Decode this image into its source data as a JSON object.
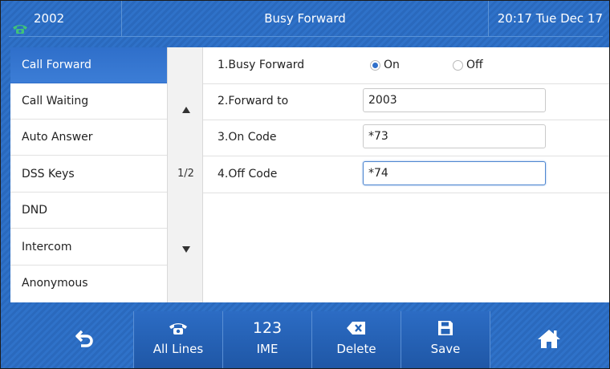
{
  "header": {
    "line_number": "2002",
    "title": "Busy Forward",
    "datetime": "20:17 Tue Dec 17",
    "phone_icon_color": "#3fc27a"
  },
  "menu": {
    "items": [
      {
        "label": "Call Forward",
        "active": true
      },
      {
        "label": "Call Waiting",
        "active": false
      },
      {
        "label": "Auto Answer",
        "active": false
      },
      {
        "label": "DSS Keys",
        "active": false
      },
      {
        "label": "DND",
        "active": false
      },
      {
        "label": "Intercom",
        "active": false
      },
      {
        "label": "Anonymous",
        "active": false
      }
    ]
  },
  "scroll": {
    "up_icon": "triangle-up-icon",
    "down_icon": "triangle-down-icon",
    "page_indicator": "1/2"
  },
  "settings": {
    "busy_forward": {
      "label": "1.Busy Forward",
      "on_label": "On",
      "off_label": "Off",
      "selected": "On"
    },
    "forward_to": {
      "label": "2.Forward to",
      "value": "2003"
    },
    "on_code": {
      "label": "3.On Code",
      "value": "*73"
    },
    "off_code": {
      "label": "4.Off Code",
      "value": "*74"
    }
  },
  "softkeys": {
    "back_icon": "back-arrow-icon",
    "all_lines": {
      "icon": "phone-icon",
      "label": "All Lines"
    },
    "ime": {
      "icon_text": "123",
      "label": "IME"
    },
    "delete": {
      "icon": "backspace-icon",
      "label": "Delete"
    },
    "save": {
      "icon": "floppy-disk-icon",
      "label": "Save"
    },
    "home_icon": "home-icon"
  },
  "colors": {
    "accent_blue": "#2f6fca",
    "background_blue": "#2f72c9"
  }
}
